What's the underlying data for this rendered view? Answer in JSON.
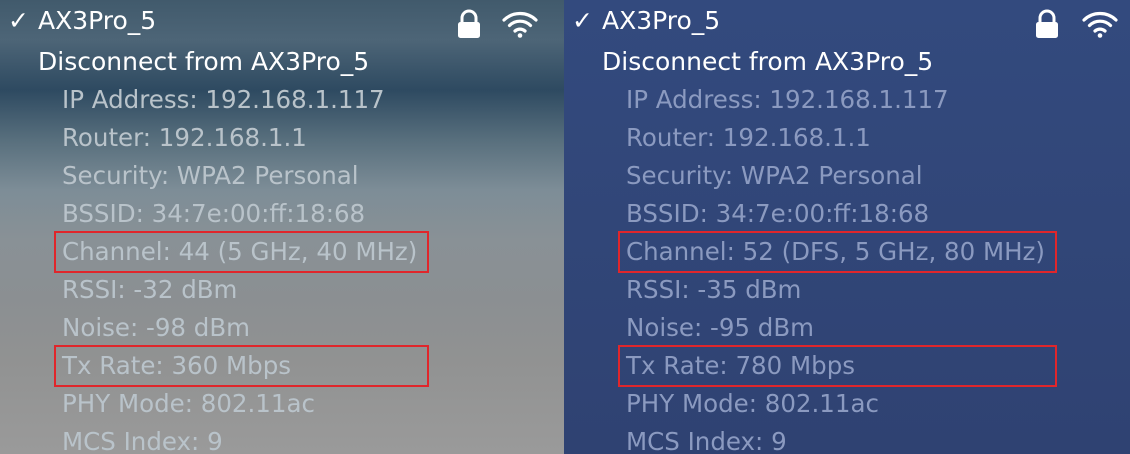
{
  "panels": [
    {
      "network": {
        "checkmark": "✓",
        "name": "AX3Pro_5",
        "lock_icon": "lock-icon",
        "wifi_icon": "wifi-icon"
      },
      "disconnect_label": "Disconnect from AX3Pro_5",
      "details": {
        "ip": "IP Address: 192.168.1.117",
        "router": "Router: 192.168.1.1",
        "security": "Security: WPA2 Personal",
        "bssid": "BSSID: 34:7e:00:ff:18:68",
        "channel": "Channel: 44 (5 GHz, 40 MHz)",
        "rssi": "RSSI: -32 dBm",
        "noise": "Noise: -98 dBm",
        "tx_rate": "Tx Rate: 360 Mbps",
        "phy_mode": "PHY Mode: 802.11ac",
        "mcs_index": "MCS Index: 9"
      },
      "highlighted_rows": [
        "channel",
        "tx_rate"
      ],
      "highlight_color": "#e0262b"
    },
    {
      "network": {
        "checkmark": "✓",
        "name": "AX3Pro_5",
        "lock_icon": "lock-icon",
        "wifi_icon": "wifi-icon"
      },
      "disconnect_label": "Disconnect from AX3Pro_5",
      "details": {
        "ip": "IP Address: 192.168.1.117",
        "router": "Router: 192.168.1.1",
        "security": "Security: WPA2 Personal",
        "bssid": "BSSID: 34:7e:00:ff:18:68",
        "channel": "Channel: 52 (DFS, 5 GHz, 80 MHz)",
        "rssi": "RSSI: -35 dBm",
        "noise": "Noise: -95 dBm",
        "tx_rate": "Tx Rate: 780 Mbps",
        "phy_mode": "PHY Mode: 802.11ac",
        "mcs_index": "MCS Index: 9"
      },
      "highlighted_rows": [
        "channel",
        "tx_rate"
      ],
      "highlight_color": "#e0262b"
    }
  ]
}
